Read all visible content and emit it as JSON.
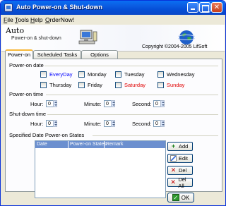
{
  "window": {
    "title": "Auto Power-on & Shut-down",
    "accent": "#0a5ae0"
  },
  "menu": {
    "file": "ile",
    "file_u": "F",
    "tools": "ools",
    "tools_u": "T",
    "help": "elp",
    "help_u": "H",
    "order": "rderNow!",
    "order_u": "O"
  },
  "banner": {
    "title": "Auto",
    "subtitle": "Power-on & shut-down",
    "copyright": "Copyright ©2004-2005 LifSoft"
  },
  "tabs": [
    {
      "label": "Power-on",
      "active": true
    },
    {
      "label": "Scheduled Tasks",
      "active": false
    },
    {
      "label": "Options",
      "active": false
    }
  ],
  "power_on_date": {
    "label": "Power-on date",
    "days": [
      {
        "label": "EveryDay",
        "color": "#0000ff",
        "checked": false
      },
      {
        "label": "Monday",
        "color": "#000000",
        "checked": false
      },
      {
        "label": "Tuesday",
        "color": "#000000",
        "checked": false
      },
      {
        "label": "Wednesday",
        "color": "#000000",
        "checked": false
      },
      {
        "label": "Thursday",
        "color": "#000000",
        "checked": false
      },
      {
        "label": "Friday",
        "color": "#000000",
        "checked": false
      },
      {
        "label": "Saturday",
        "color": "#e00000",
        "checked": false
      },
      {
        "label": "Sunday",
        "color": "#e00000",
        "checked": false
      }
    ]
  },
  "power_on_time": {
    "label": "Power-on time",
    "hour_label": "Hour:",
    "hour": "0",
    "minute_label": "Minute:",
    "minute": "0",
    "second_label": "Second:",
    "second": "0"
  },
  "shut_down_time": {
    "label": "Shut-down time",
    "hour_label": "Hour:",
    "hour": "0",
    "minute_label": "Minute:",
    "minute": "0",
    "second_label": "Second:",
    "second": "0"
  },
  "states": {
    "label": "Specified Date Power-on States",
    "columns": [
      "Date",
      "Power-on States",
      "Remark"
    ],
    "rows": []
  },
  "buttons": {
    "add": "Add",
    "edit": "Edit",
    "del": "Del",
    "del_all": "Del All",
    "ok": "OK"
  }
}
